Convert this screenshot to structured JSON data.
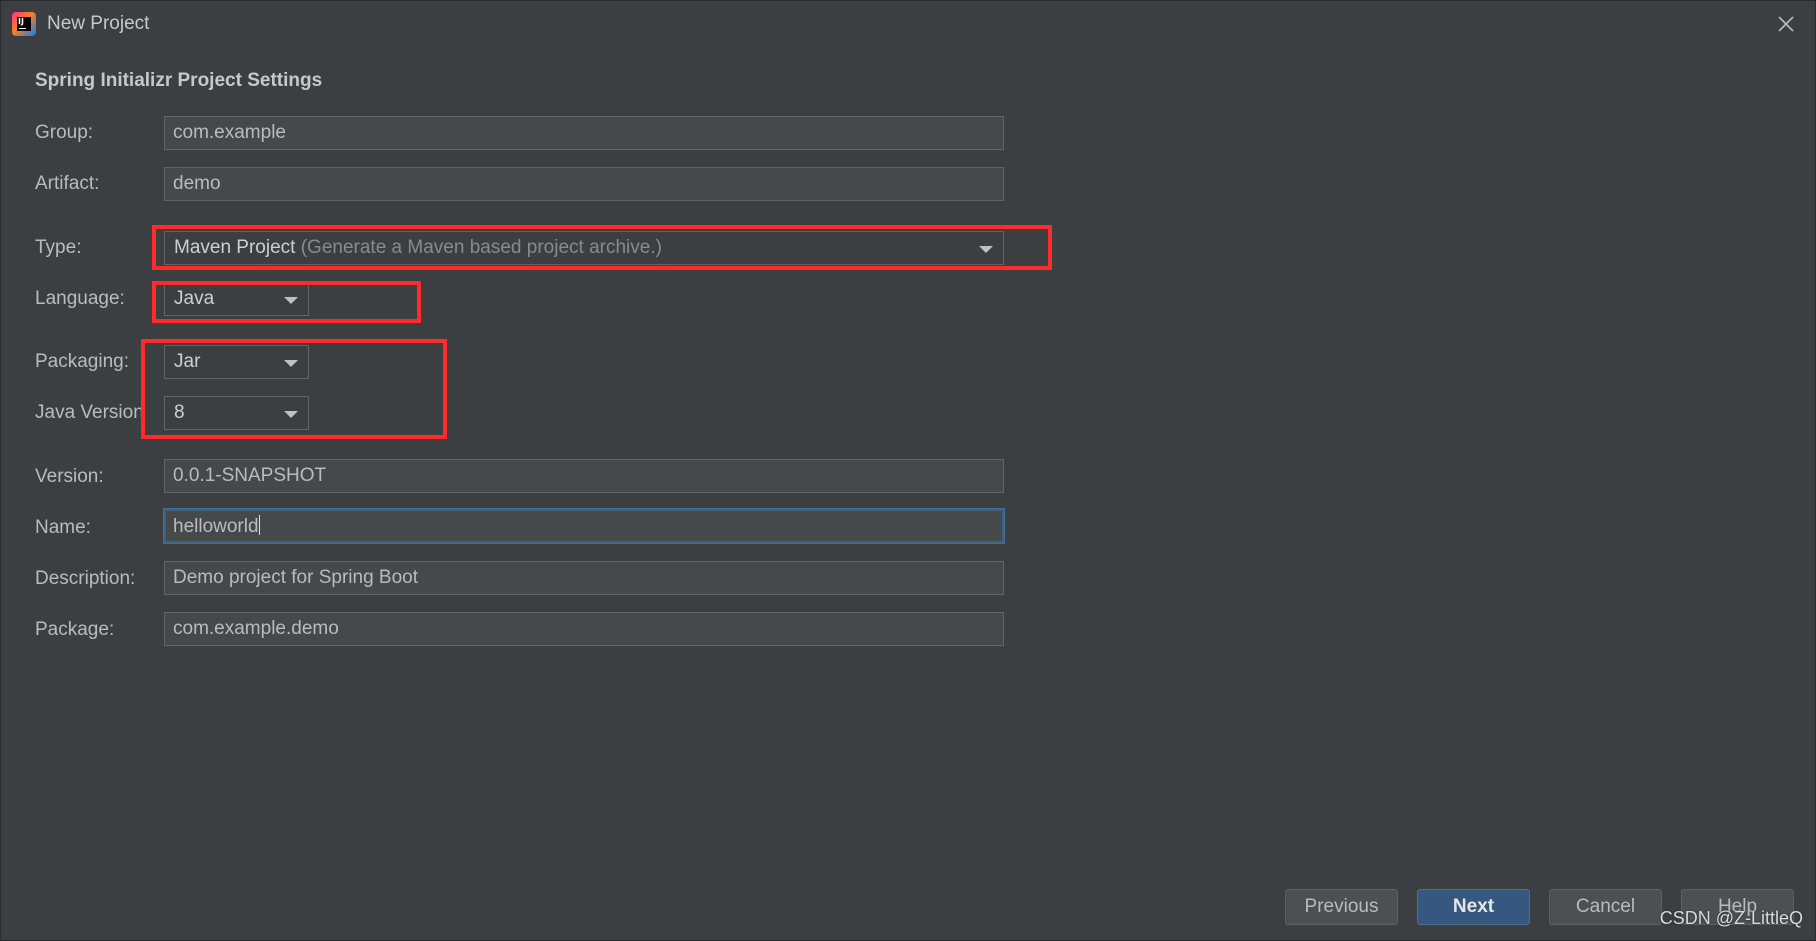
{
  "window": {
    "title": "New Project"
  },
  "section_title": "Spring Initializr Project Settings",
  "fields": {
    "group": {
      "label": "Group:",
      "value": "com.example"
    },
    "artifact": {
      "label": "Artifact:",
      "value": "demo"
    },
    "type": {
      "label": "Type:",
      "value": "Maven Project",
      "hint": "(Generate a Maven based project archive.)"
    },
    "language": {
      "label": "Language:",
      "value": "Java"
    },
    "packaging": {
      "label": "Packaging:",
      "value": "Jar"
    },
    "java_version": {
      "label": "Java Version",
      "value": "8"
    },
    "version": {
      "label": "Version:",
      "value": "0.0.1-SNAPSHOT"
    },
    "name": {
      "label": "Name:",
      "value": "helloworld"
    },
    "description": {
      "label": "Description:",
      "value": "Demo project for Spring Boot"
    },
    "package": {
      "label": "Package:",
      "value": "com.example.demo"
    }
  },
  "buttons": {
    "previous": "Previous",
    "next": "Next",
    "cancel": "Cancel",
    "help": "Help"
  },
  "watermark": "CSDN @Z-LittleQ",
  "colors": {
    "highlight_box": "#ff2b2b",
    "primary_button": "#365880",
    "focus_border": "#3d6185"
  },
  "icons": {
    "app": "intellij-idea-icon",
    "close": "close-icon",
    "dropdown": "chevron-down-icon"
  }
}
